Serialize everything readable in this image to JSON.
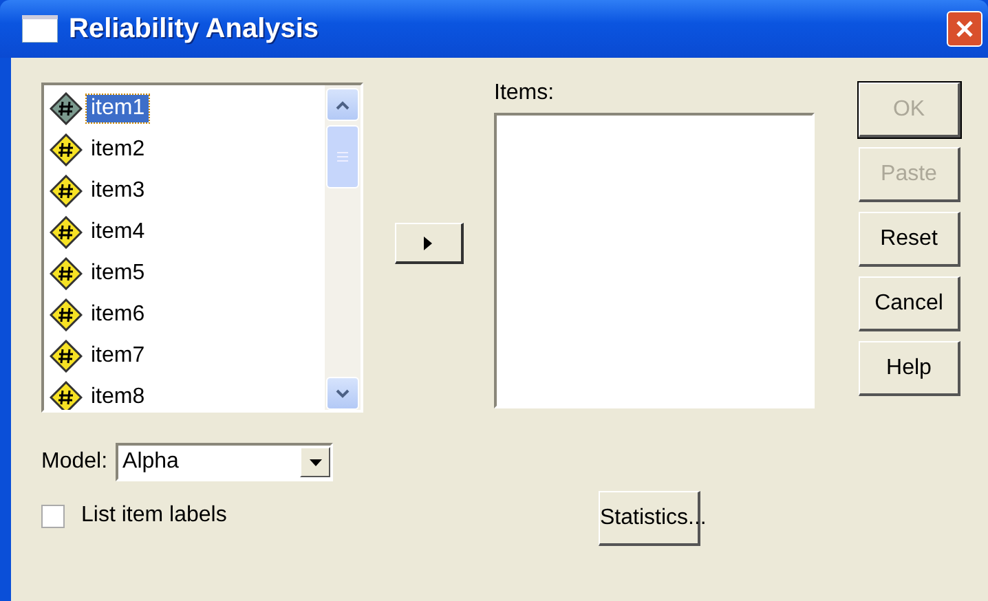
{
  "window": {
    "title": "Reliability Analysis"
  },
  "variables": [
    {
      "label": "item1",
      "selected": true
    },
    {
      "label": "item2",
      "selected": false
    },
    {
      "label": "item3",
      "selected": false
    },
    {
      "label": "item4",
      "selected": false
    },
    {
      "label": "item5",
      "selected": false
    },
    {
      "label": "item6",
      "selected": false
    },
    {
      "label": "item7",
      "selected": false
    },
    {
      "label": "item8",
      "selected": false
    }
  ],
  "items_label": "Items:",
  "buttons": [
    {
      "label": "OK",
      "disabled": true,
      "default": true
    },
    {
      "label": "Paste",
      "disabled": true,
      "default": false
    },
    {
      "label": "Reset",
      "disabled": false,
      "default": false
    },
    {
      "label": "Cancel",
      "disabled": false,
      "default": false
    },
    {
      "label": "Help",
      "disabled": false,
      "default": false
    }
  ],
  "model": {
    "label": "Model:",
    "value": "Alpha"
  },
  "list_item_labels": {
    "label": "List item labels",
    "checked": false
  },
  "statistics_button": "Statistics..."
}
